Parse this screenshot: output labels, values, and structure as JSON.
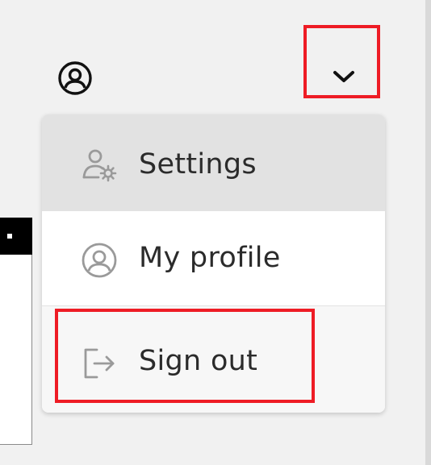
{
  "header": {
    "user_icon": "user-circle-icon",
    "dropdown_icon": "chevron-down-icon"
  },
  "menu": {
    "items": [
      {
        "label": "Settings",
        "icon": "user-settings-icon"
      },
      {
        "label": "My profile",
        "icon": "user-circle-icon"
      },
      {
        "label": "Sign out",
        "icon": "sign-out-icon"
      }
    ]
  },
  "colors": {
    "highlight": "#ee1c25",
    "hover_background": "#e2e2e2",
    "text": "#2b2b2b",
    "icon": "#9a9a9a"
  }
}
